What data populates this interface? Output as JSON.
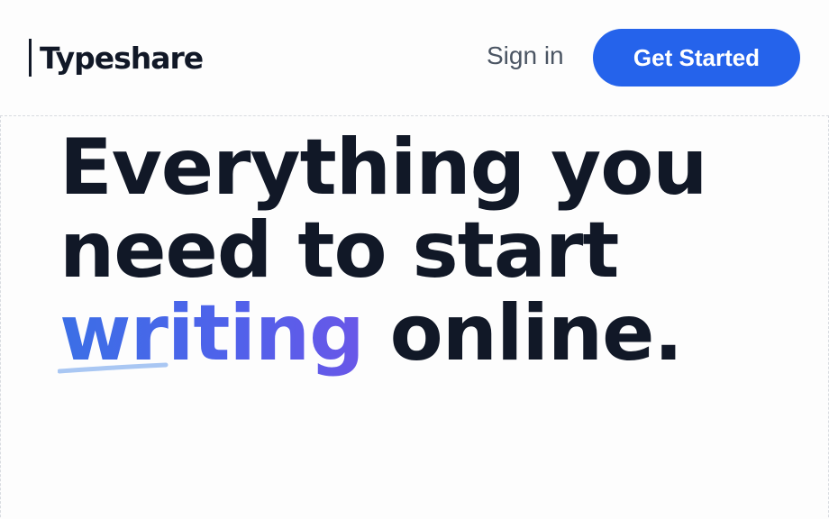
{
  "header": {
    "logo_text": "Typeshare",
    "sign_in_label": "Sign in",
    "get_started_label": "Get Started"
  },
  "hero": {
    "line1": "Everything you",
    "line2": "need to start",
    "highlight_word": "writing",
    "line3_rest": " online."
  },
  "colors": {
    "accent": "#2563eb",
    "text": "#111827",
    "muted": "#4b5563",
    "highlight_gradient_start": "#3b6fe6",
    "highlight_gradient_end": "#6a57e8",
    "underline": "#a9c7f3"
  }
}
